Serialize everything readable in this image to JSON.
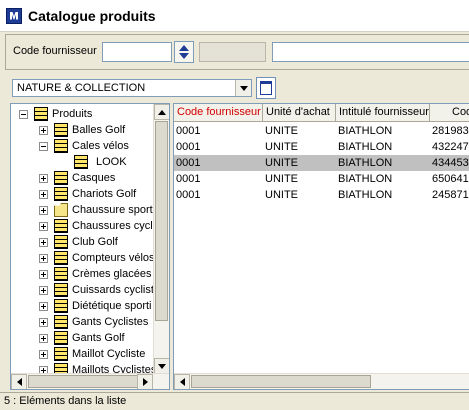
{
  "window": {
    "title": "Catalogue produits"
  },
  "filter": {
    "supplier_code_label": "Code fournisseur",
    "supplier_code_value": "",
    "field2_value": "",
    "field3_value": ""
  },
  "collection": {
    "selected": "NATURE & COLLECTION"
  },
  "tree": {
    "items": [
      {
        "label": "Produits",
        "level": 0,
        "expander": "minus",
        "icon": "grid-folder-icon"
      },
      {
        "label": "Balles Golf",
        "level": 1,
        "expander": "plus",
        "icon": "grid-folder-icon"
      },
      {
        "label": "Cales vélos",
        "level": 1,
        "expander": "minus",
        "icon": "grid-folder-icon"
      },
      {
        "label": "LOOK",
        "level": 2,
        "expander": "none",
        "icon": "grid-folder-icon"
      },
      {
        "label": "Casques",
        "level": 1,
        "expander": "plus",
        "icon": "grid-folder-icon"
      },
      {
        "label": "Chariots Golf",
        "level": 1,
        "expander": "plus",
        "icon": "grid-folder-icon"
      },
      {
        "label": "Chaussure sport",
        "level": 1,
        "expander": "plus",
        "icon": "open-folder-icon"
      },
      {
        "label": "Chaussures cycl",
        "level": 1,
        "expander": "plus",
        "icon": "grid-folder-icon"
      },
      {
        "label": "Club Golf",
        "level": 1,
        "expander": "plus",
        "icon": "grid-folder-icon"
      },
      {
        "label": "Compteurs vélos",
        "level": 1,
        "expander": "plus",
        "icon": "grid-folder-icon"
      },
      {
        "label": "Crèmes glacées",
        "level": 1,
        "expander": "plus",
        "icon": "grid-folder-icon"
      },
      {
        "label": "Cuissards cyclist",
        "level": 1,
        "expander": "plus",
        "icon": "grid-folder-icon"
      },
      {
        "label": "Diététique sporti",
        "level": 1,
        "expander": "plus",
        "icon": "grid-folder-icon"
      },
      {
        "label": "Gants Cyclistes",
        "level": 1,
        "expander": "plus",
        "icon": "grid-folder-icon"
      },
      {
        "label": "Gants Golf",
        "level": 1,
        "expander": "plus",
        "icon": "grid-folder-icon"
      },
      {
        "label": "Maillot Cycliste",
        "level": 1,
        "expander": "plus",
        "icon": "grid-folder-icon"
      },
      {
        "label": "Maillots Cyclistes",
        "level": 1,
        "expander": "plus",
        "icon": "grid-folder-icon"
      }
    ]
  },
  "table": {
    "columns": [
      "Code fournisseur",
      "Unité d'achat",
      "Intitulé fournisseur",
      "Code"
    ],
    "active_column": 0,
    "selected_row": 2,
    "rows": [
      [
        "0001",
        "UNITE",
        "BIATHLON",
        "281983"
      ],
      [
        "0001",
        "UNITE",
        "BIATHLON",
        "432247"
      ],
      [
        "0001",
        "UNITE",
        "BIATHLON",
        "434453"
      ],
      [
        "0001",
        "UNITE",
        "BIATHLON",
        "650641"
      ],
      [
        "0001",
        "UNITE",
        "BIATHLON",
        "245871"
      ]
    ]
  },
  "status": {
    "text": "5 : Eléments dans la liste"
  },
  "colors": {
    "selected_row": "#c0c0c0",
    "active_header": "#d40000",
    "folder": "#ffe56a"
  }
}
